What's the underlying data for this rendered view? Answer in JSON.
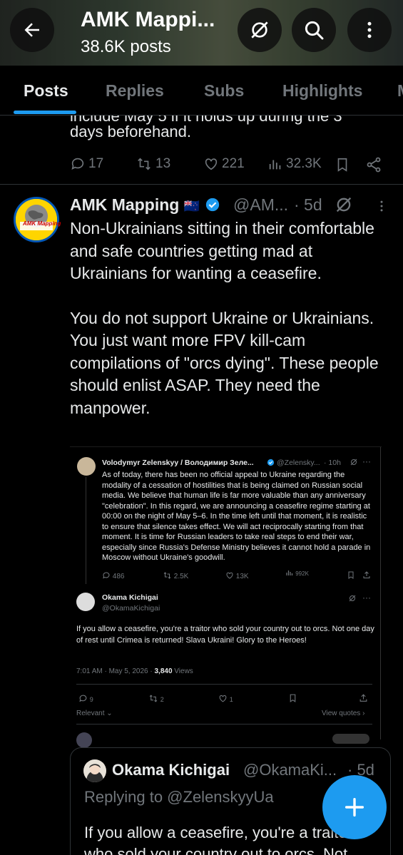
{
  "header": {
    "title": "AMK Mappi...",
    "post_count": "38.6K posts"
  },
  "tabs": [
    {
      "label": "Posts"
    },
    {
      "label": "Replies"
    },
    {
      "label": "Subs"
    },
    {
      "label": "Highlights"
    },
    {
      "label": "M"
    }
  ],
  "post1": {
    "text_partial": "include May 5 if it holds up during the 3",
    "text_last_line": "days beforehand.",
    "replies": "17",
    "reposts": "13",
    "likes": "221",
    "views": "32.3K"
  },
  "post2": {
    "avatar_text": "AMK Mapping",
    "name": "AMK Mapping",
    "flag": "🇳🇿",
    "handle": "@AM...",
    "time": "· 5d",
    "body_p1": "Non-Ukrainians sitting in their comfortable and safe countries getting mad at Ukrainians for wanting a ceasefire.",
    "body_p2": "You do not support Ukraine or Ukrainians. You just want more FPV kill-cam compilations of \"orcs dying\". These people should enlist ASAP. They need the manpower."
  },
  "embed": {
    "z_name": "Volodymyr Zelenskyy / Володимир Зеле...",
    "z_handle": "@Zelensky...",
    "z_time": "· 10h",
    "z_text": "As of today, there has been no official appeal to Ukraine regarding the modality of a cessation of hostilities that is being claimed on Russian social media. We believe that human life is far more valuable than any anniversary \"celebration\". In this regard, we are announcing a ceasefire regime starting at 00:00 on the night of May 5–6. In the time left until that moment, it is realistic to ensure that silence takes effect. We will act reciprocally starting from that moment. It is time for Russian leaders to take real steps to end their war, especially since Russia's Defense Ministry believes it cannot hold a parade in Moscow without Ukraine's goodwill.",
    "z_replies": "486",
    "z_reposts": "2.5K",
    "z_likes": "13K",
    "z_views": "992K",
    "o_name": "Okama Kichigai",
    "o_handle": "@OkamaKichigai",
    "o_text": "If you allow a ceasefire, you're a traitor who sold your country out to orcs. Not one day of rest until Crimea is returned! Slava Ukraini! Glory to the Heroes!",
    "o_time": "7:01 AM · May 5, 2026 · ",
    "o_views": "3,840",
    "o_views_label": " Views",
    "o_replies": "9",
    "o_reposts": "2",
    "o_likes": "1",
    "relevant": "Relevant",
    "view_quotes": "View quotes"
  },
  "reply_card": {
    "name": "Okama Kichigai",
    "handle": "@OkamaKi...",
    "time": "· 5d",
    "replying_to": "Replying to @ZelenskyyUa",
    "text": "If you allow a ceasefire, you're a traitor who sold your country out to orcs. Not"
  },
  "colors": {
    "accent": "#1d9bf0",
    "muted": "#71767b",
    "text": "#e7e9ea",
    "background": "#000000"
  },
  "icons": [
    "back-arrow-icon",
    "mute-icon",
    "search-icon",
    "more-vertical-icon",
    "reply-icon",
    "repost-icon",
    "like-icon",
    "views-icon",
    "bookmark-icon",
    "share-icon",
    "verified-icon",
    "grok-icon",
    "compose-plus-icon"
  ]
}
